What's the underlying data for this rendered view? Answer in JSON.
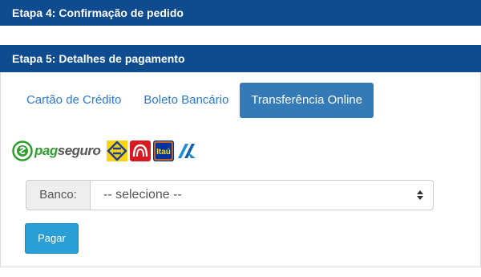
{
  "step4": {
    "title": "Etapa 4: Confirmação de pedido"
  },
  "step5": {
    "title": "Etapa 5: Detalhes de pagamento"
  },
  "tabs": [
    {
      "label": "Cartão de Crédito",
      "active": false
    },
    {
      "label": "Boleto Bancário",
      "active": false
    },
    {
      "label": "Transferência Online",
      "active": true
    }
  ],
  "logos": {
    "pagseguro_pag": "pag",
    "pagseguro_seguro": "seguro",
    "itau_text": "Itaú"
  },
  "bank_field": {
    "label": "Banco:",
    "value": "-- selecione --"
  },
  "pay_button": {
    "label": "Pagar"
  },
  "colors": {
    "header": "#0f4c8f",
    "tab_active": "#337ab7",
    "link": "#2a7bd1",
    "pay_button": "#2a9fd6",
    "pagseguro_green": "#2f9e2f",
    "bb_yellow": "#f7d417",
    "bradesco_red": "#d71920",
    "itau_blue": "#003399",
    "itau_orange": "#ff7200"
  }
}
